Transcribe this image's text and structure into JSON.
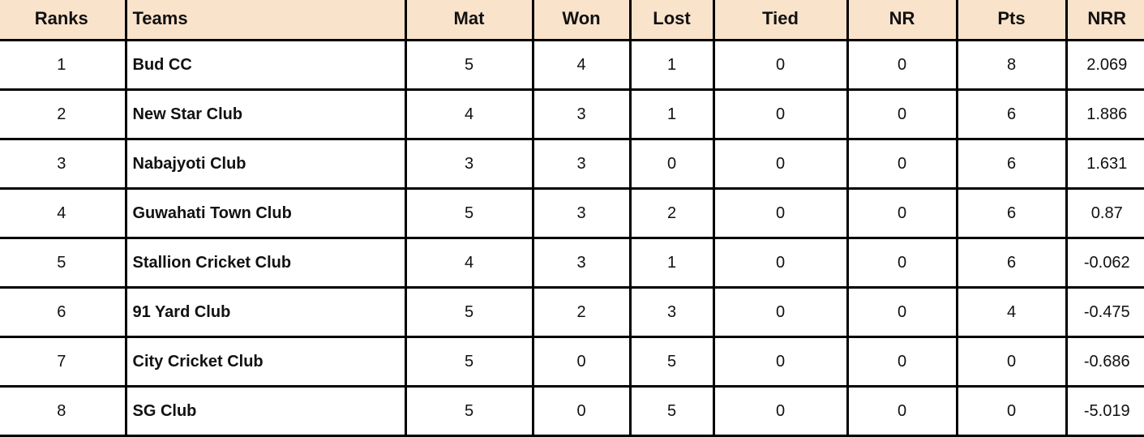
{
  "table": {
    "header_bg": "#fae3cb",
    "columns": [
      "Ranks",
      "Teams",
      "Mat",
      "Won",
      "Lost",
      "Tied",
      "NR",
      "Pts",
      "NRR"
    ],
    "rows": [
      {
        "rank": "1",
        "team": "Bud CC",
        "mat": "5",
        "won": "4",
        "lost": "1",
        "tied": "0",
        "nr": "0",
        "pts": "8",
        "nrr": "2.069"
      },
      {
        "rank": "2",
        "team": "New Star Club",
        "mat": "4",
        "won": "3",
        "lost": "1",
        "tied": "0",
        "nr": "0",
        "pts": "6",
        "nrr": "1.886"
      },
      {
        "rank": "3",
        "team": "Nabajyoti Club",
        "mat": "3",
        "won": "3",
        "lost": "0",
        "tied": "0",
        "nr": "0",
        "pts": "6",
        "nrr": "1.631"
      },
      {
        "rank": "4",
        "team": "Guwahati Town Club",
        "mat": "5",
        "won": "3",
        "lost": "2",
        "tied": "0",
        "nr": "0",
        "pts": "6",
        "nrr": "0.87"
      },
      {
        "rank": "5",
        "team": "Stallion Cricket Club",
        "mat": "4",
        "won": "3",
        "lost": "1",
        "tied": "0",
        "nr": "0",
        "pts": "6",
        "nrr": "-0.062"
      },
      {
        "rank": "6",
        "team": "91 Yard Club",
        "mat": "5",
        "won": "2",
        "lost": "3",
        "tied": "0",
        "nr": "0",
        "pts": "4",
        "nrr": "-0.475"
      },
      {
        "rank": "7",
        "team": "City Cricket Club",
        "mat": "5",
        "won": "0",
        "lost": "5",
        "tied": "0",
        "nr": "0",
        "pts": "0",
        "nrr": "-0.686"
      },
      {
        "rank": "8",
        "team": "SG Club",
        "mat": "5",
        "won": "0",
        "lost": "5",
        "tied": "0",
        "nr": "0",
        "pts": "0",
        "nrr": "-5.019"
      }
    ]
  }
}
